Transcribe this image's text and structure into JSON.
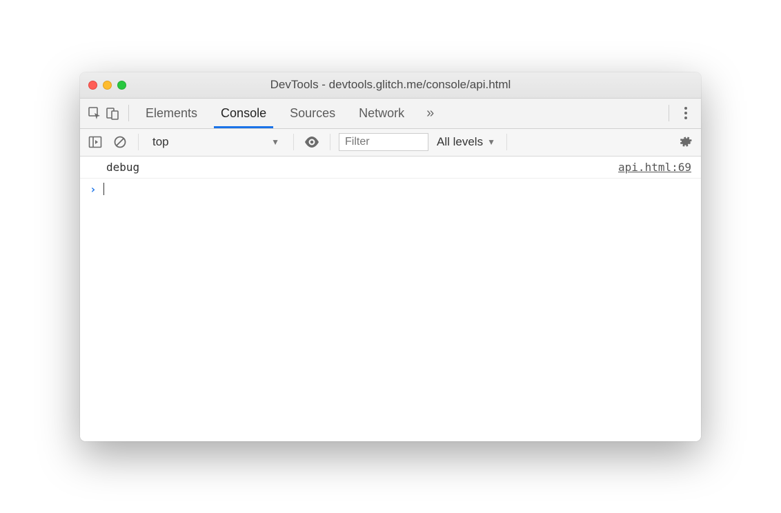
{
  "window": {
    "title": "DevTools - devtools.glitch.me/console/api.html"
  },
  "tabs": {
    "items": [
      "Elements",
      "Console",
      "Sources",
      "Network"
    ],
    "active_index": 1,
    "more_glyph": "»"
  },
  "filterbar": {
    "context": "top",
    "filter_placeholder": "Filter",
    "levels_label": "All levels"
  },
  "console": {
    "entries": [
      {
        "message": "debug",
        "source": "api.html:69"
      }
    ],
    "prompt_glyph": "›"
  },
  "icons": {
    "inspect": "inspect-icon",
    "device": "device-icon",
    "sidebar": "sidebar-icon",
    "clear": "clear-icon",
    "eye": "eye-icon",
    "gear": "gear-icon",
    "kebab": "kebab-icon",
    "chevron_down": "▼"
  }
}
